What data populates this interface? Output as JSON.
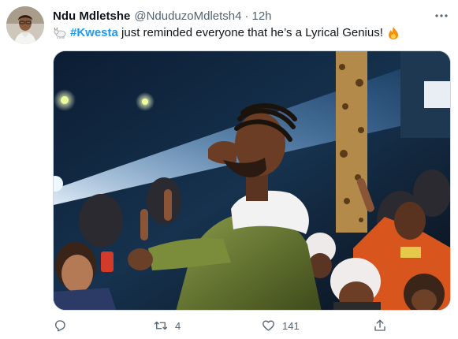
{
  "tweet": {
    "author_name": "Ndu Mdletshe",
    "author_handle": "@NduduzoMdletsh4",
    "separator": "·",
    "time": "12h",
    "hashtag": "#Kwesta",
    "text_after": " just reminded everyone that he’s a Lyrical Genius!"
  },
  "icons": {
    "avatar": "profile-avatar",
    "more": "more-icon",
    "leading_emoji": "goat-emoji",
    "trailing_emoji": "fire-emoji",
    "reply": "reply-icon",
    "retweet": "retweet-icon",
    "like": "like-icon",
    "share": "share-icon"
  },
  "actions": {
    "reply_count": "",
    "retweet_count": "4",
    "like_count": "141"
  },
  "colors": {
    "accent": "#1d9bf0",
    "secondary_text": "#536471",
    "primary_text": "#0f1419"
  }
}
